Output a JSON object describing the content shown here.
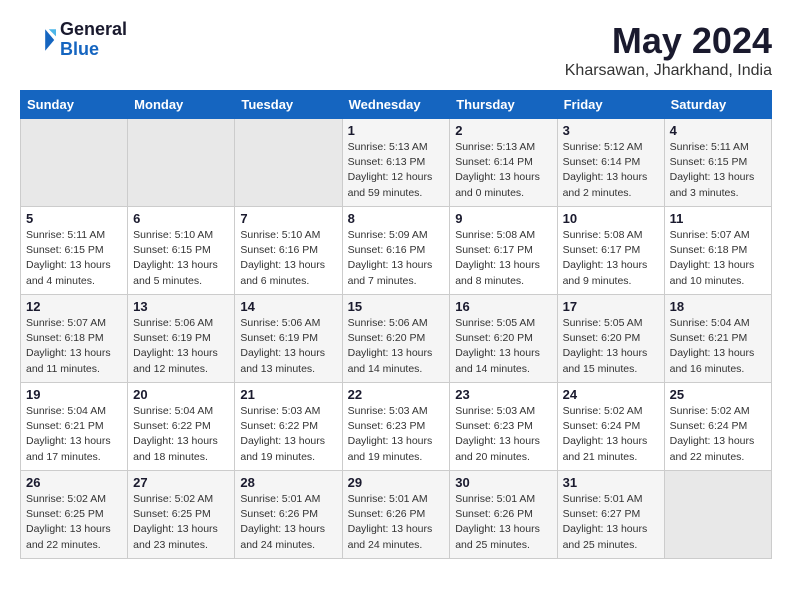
{
  "logo": {
    "line1": "General",
    "line2": "Blue"
  },
  "title": {
    "month_year": "May 2024",
    "location": "Kharsawan, Jharkhand, India"
  },
  "days_of_week": [
    "Sunday",
    "Monday",
    "Tuesday",
    "Wednesday",
    "Thursday",
    "Friday",
    "Saturday"
  ],
  "weeks": [
    [
      {
        "day": "",
        "info": ""
      },
      {
        "day": "",
        "info": ""
      },
      {
        "day": "",
        "info": ""
      },
      {
        "day": "1",
        "info": "Sunrise: 5:13 AM\nSunset: 6:13 PM\nDaylight: 12 hours\nand 59 minutes."
      },
      {
        "day": "2",
        "info": "Sunrise: 5:13 AM\nSunset: 6:14 PM\nDaylight: 13 hours\nand 0 minutes."
      },
      {
        "day": "3",
        "info": "Sunrise: 5:12 AM\nSunset: 6:14 PM\nDaylight: 13 hours\nand 2 minutes."
      },
      {
        "day": "4",
        "info": "Sunrise: 5:11 AM\nSunset: 6:15 PM\nDaylight: 13 hours\nand 3 minutes."
      }
    ],
    [
      {
        "day": "5",
        "info": "Sunrise: 5:11 AM\nSunset: 6:15 PM\nDaylight: 13 hours\nand 4 minutes."
      },
      {
        "day": "6",
        "info": "Sunrise: 5:10 AM\nSunset: 6:15 PM\nDaylight: 13 hours\nand 5 minutes."
      },
      {
        "day": "7",
        "info": "Sunrise: 5:10 AM\nSunset: 6:16 PM\nDaylight: 13 hours\nand 6 minutes."
      },
      {
        "day": "8",
        "info": "Sunrise: 5:09 AM\nSunset: 6:16 PM\nDaylight: 13 hours\nand 7 minutes."
      },
      {
        "day": "9",
        "info": "Sunrise: 5:08 AM\nSunset: 6:17 PM\nDaylight: 13 hours\nand 8 minutes."
      },
      {
        "day": "10",
        "info": "Sunrise: 5:08 AM\nSunset: 6:17 PM\nDaylight: 13 hours\nand 9 minutes."
      },
      {
        "day": "11",
        "info": "Sunrise: 5:07 AM\nSunset: 6:18 PM\nDaylight: 13 hours\nand 10 minutes."
      }
    ],
    [
      {
        "day": "12",
        "info": "Sunrise: 5:07 AM\nSunset: 6:18 PM\nDaylight: 13 hours\nand 11 minutes."
      },
      {
        "day": "13",
        "info": "Sunrise: 5:06 AM\nSunset: 6:19 PM\nDaylight: 13 hours\nand 12 minutes."
      },
      {
        "day": "14",
        "info": "Sunrise: 5:06 AM\nSunset: 6:19 PM\nDaylight: 13 hours\nand 13 minutes."
      },
      {
        "day": "15",
        "info": "Sunrise: 5:06 AM\nSunset: 6:20 PM\nDaylight: 13 hours\nand 14 minutes."
      },
      {
        "day": "16",
        "info": "Sunrise: 5:05 AM\nSunset: 6:20 PM\nDaylight: 13 hours\nand 14 minutes."
      },
      {
        "day": "17",
        "info": "Sunrise: 5:05 AM\nSunset: 6:20 PM\nDaylight: 13 hours\nand 15 minutes."
      },
      {
        "day": "18",
        "info": "Sunrise: 5:04 AM\nSunset: 6:21 PM\nDaylight: 13 hours\nand 16 minutes."
      }
    ],
    [
      {
        "day": "19",
        "info": "Sunrise: 5:04 AM\nSunset: 6:21 PM\nDaylight: 13 hours\nand 17 minutes."
      },
      {
        "day": "20",
        "info": "Sunrise: 5:04 AM\nSunset: 6:22 PM\nDaylight: 13 hours\nand 18 minutes."
      },
      {
        "day": "21",
        "info": "Sunrise: 5:03 AM\nSunset: 6:22 PM\nDaylight: 13 hours\nand 19 minutes."
      },
      {
        "day": "22",
        "info": "Sunrise: 5:03 AM\nSunset: 6:23 PM\nDaylight: 13 hours\nand 19 minutes."
      },
      {
        "day": "23",
        "info": "Sunrise: 5:03 AM\nSunset: 6:23 PM\nDaylight: 13 hours\nand 20 minutes."
      },
      {
        "day": "24",
        "info": "Sunrise: 5:02 AM\nSunset: 6:24 PM\nDaylight: 13 hours\nand 21 minutes."
      },
      {
        "day": "25",
        "info": "Sunrise: 5:02 AM\nSunset: 6:24 PM\nDaylight: 13 hours\nand 22 minutes."
      }
    ],
    [
      {
        "day": "26",
        "info": "Sunrise: 5:02 AM\nSunset: 6:25 PM\nDaylight: 13 hours\nand 22 minutes."
      },
      {
        "day": "27",
        "info": "Sunrise: 5:02 AM\nSunset: 6:25 PM\nDaylight: 13 hours\nand 23 minutes."
      },
      {
        "day": "28",
        "info": "Sunrise: 5:01 AM\nSunset: 6:26 PM\nDaylight: 13 hours\nand 24 minutes."
      },
      {
        "day": "29",
        "info": "Sunrise: 5:01 AM\nSunset: 6:26 PM\nDaylight: 13 hours\nand 24 minutes."
      },
      {
        "day": "30",
        "info": "Sunrise: 5:01 AM\nSunset: 6:26 PM\nDaylight: 13 hours\nand 25 minutes."
      },
      {
        "day": "31",
        "info": "Sunrise: 5:01 AM\nSunset: 6:27 PM\nDaylight: 13 hours\nand 25 minutes."
      },
      {
        "day": "",
        "info": ""
      }
    ]
  ]
}
